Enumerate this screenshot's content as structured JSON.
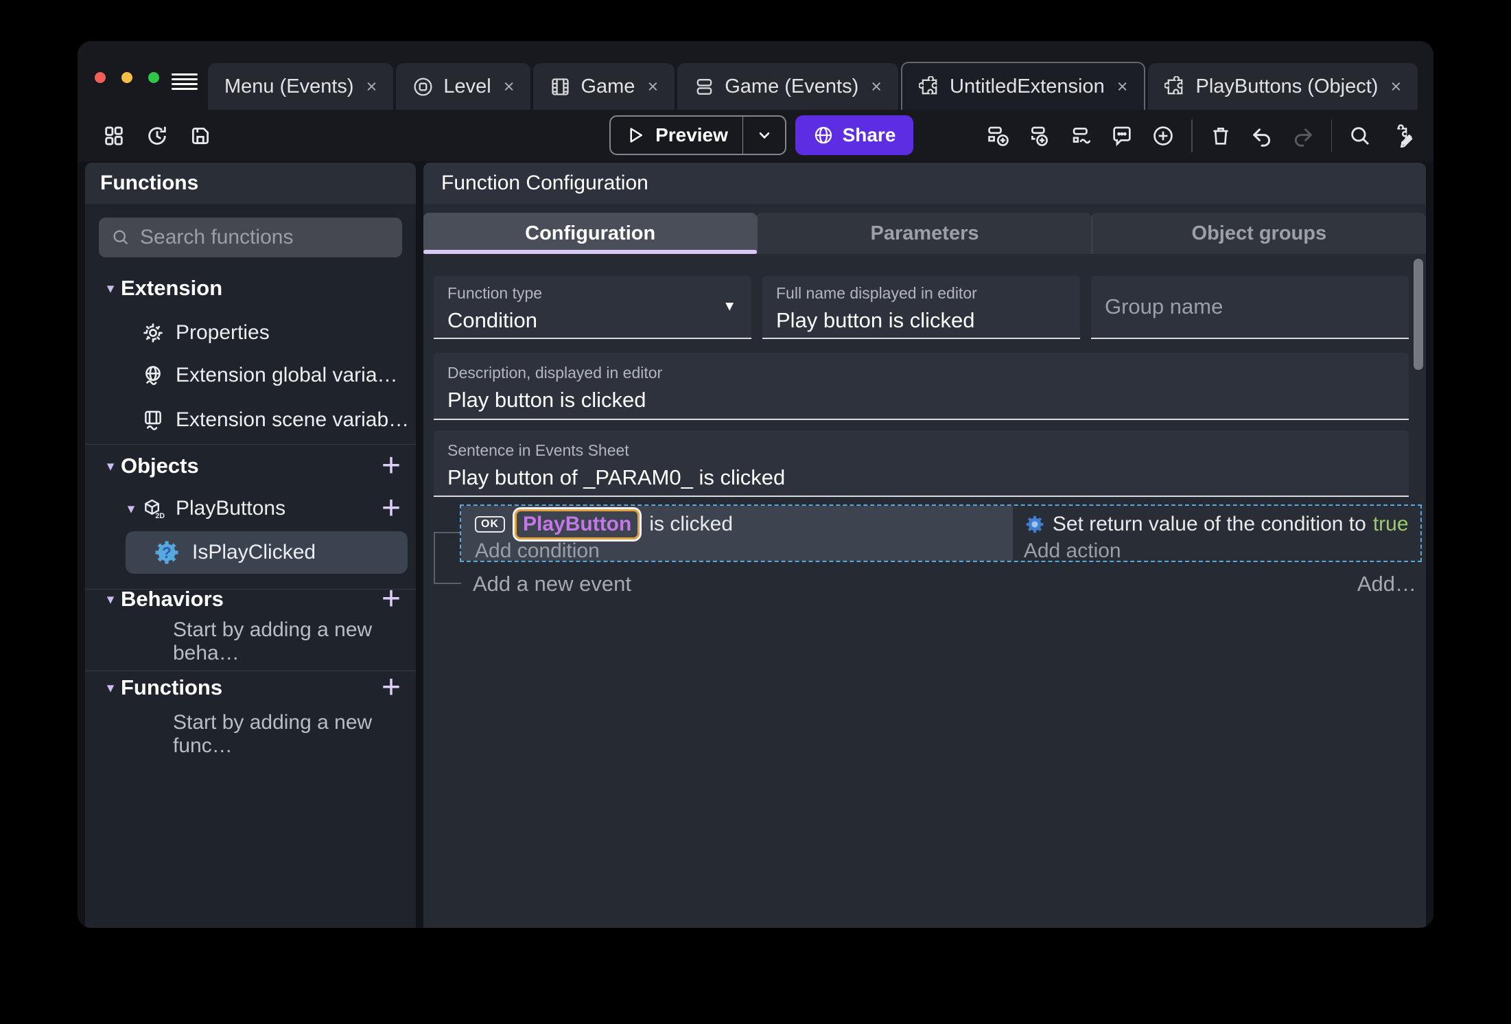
{
  "colors": {
    "accent": "#5d2de4",
    "tab-underline": "#d7c9f6",
    "object-text": "#c478e8",
    "object-border": "#e2a33c",
    "true-green": "#9ccc65",
    "selection-blue": "#57aadf",
    "function-blue": "#58a8e0",
    "lavender": "#cdbcf2"
  },
  "ui": {
    "close_glyph": "×",
    "add_glyph": "+",
    "chevron_glyph": "▾",
    "caret_glyph": "▼",
    "ellipsis": "…"
  },
  "window": {
    "tabs": [
      {
        "label": "Menu (Events)"
      },
      {
        "label": "Level"
      },
      {
        "label": "Game"
      },
      {
        "label": "Game (Events)"
      },
      {
        "label": "UntitledExtension"
      },
      {
        "label": "PlayButtons (Object)"
      }
    ]
  },
  "toolbar": {
    "preview_label": "Preview",
    "share_label": "Share"
  },
  "sidebar": {
    "title": "Functions",
    "search_placeholder": "Search functions",
    "extension": {
      "label": "Extension",
      "items": [
        {
          "label": "Properties"
        },
        {
          "label": "Extension global varia…"
        },
        {
          "label": "Extension scene variab…"
        }
      ]
    },
    "objects": {
      "label": "Objects",
      "object_label": "PlayButtons",
      "function_label": "IsPlayClicked"
    },
    "behaviors": {
      "label": "Behaviors",
      "empty_text": "Start by adding a new beha…"
    },
    "functions": {
      "label": "Functions",
      "empty_text": "Start by adding a new func…"
    }
  },
  "main": {
    "header": "Function Configuration",
    "tabs": [
      {
        "label": "Configuration"
      },
      {
        "label": "Parameters"
      },
      {
        "label": "Object groups"
      }
    ],
    "fields": {
      "function_type": {
        "label": "Function type",
        "value": "Condition"
      },
      "full_name": {
        "label": "Full name displayed in editor",
        "value": "Play button is clicked"
      },
      "group_name": {
        "placeholder": "Group name"
      },
      "description": {
        "label": "Description, displayed in editor",
        "value": "Play button is clicked"
      },
      "sentence": {
        "label": "Sentence in Events Sheet",
        "value": "Play button of _PARAM0_ is clicked"
      }
    },
    "events": {
      "condition": {
        "ok_badge": "OK",
        "object": "PlayButton",
        "suffix": "is clicked",
        "add_label": "Add condition"
      },
      "action": {
        "text": "Set return value of the condition to",
        "value": "true",
        "add_label": "Add action"
      },
      "add_event_label": "Add a new event",
      "add_more_label": "Add…"
    }
  }
}
